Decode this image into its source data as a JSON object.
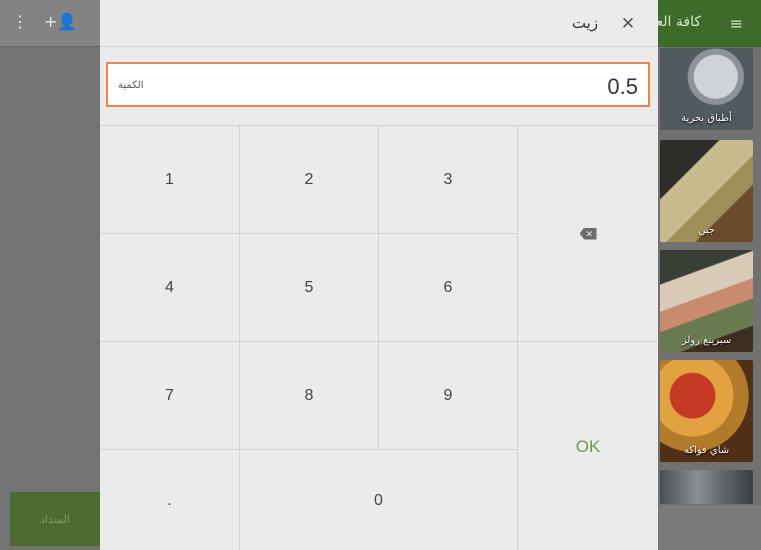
{
  "background": {
    "app_title": "كافة العناصر",
    "pay_button_label": "السداد",
    "tiles": [
      {
        "label": "أطباق بحرية"
      },
      {
        "label": "جبن"
      },
      {
        "label": "سبرينغ رولز"
      },
      {
        "label": "شاي فواكه"
      }
    ],
    "icons": {
      "overflow": "overflow-menu-icon",
      "add_person": "add-person-icon",
      "menu": "hamburger-menu-icon"
    }
  },
  "dialog": {
    "title": "زيت",
    "close_icon": "close-icon",
    "quantity": {
      "label": "الكمية",
      "value": "0.5"
    },
    "keypad": {
      "digits": [
        "1",
        "2",
        "3",
        "4",
        "5",
        "6",
        "7",
        "8",
        "9",
        "0"
      ],
      "decimal": ".",
      "backspace_icon": "backspace-icon",
      "ok_label": "OK"
    }
  },
  "colors": {
    "accent_orange": "#f08447",
    "ok_green": "#6a9b4a",
    "app_bar_green": "#3c6b2a"
  }
}
